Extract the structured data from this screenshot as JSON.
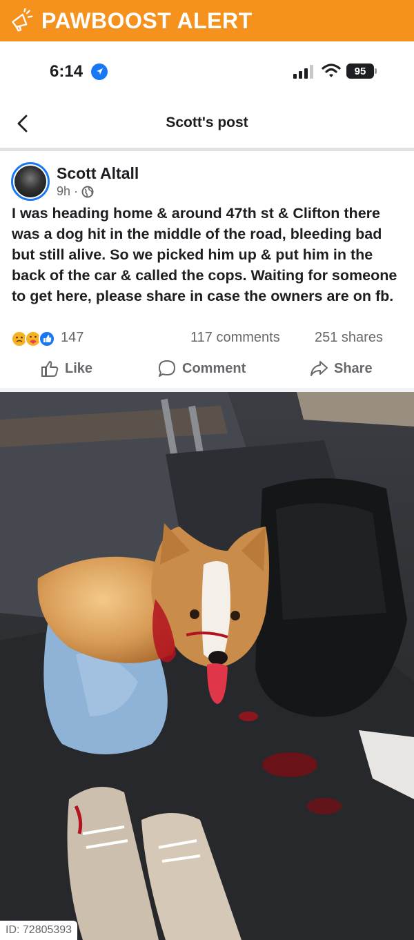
{
  "banner": {
    "title": "PAWBOOST ALERT",
    "color": "#f5921e",
    "icon": "megaphone-icon"
  },
  "status_bar": {
    "time": "6:14",
    "battery": "95"
  },
  "nav": {
    "title": "Scott's post"
  },
  "post": {
    "author": "Scott Altall",
    "time": "9h",
    "text": "I was heading home & around 47th st & Clifton there was a dog hit in the middle of the road, bleeding bad but still alive.  So we picked him up & put him in the back of the car & called the cops.  Waiting for someone to get here, please share in case the owners are on fb.",
    "reaction_count": "147",
    "comments": "117 comments",
    "shares": "251 shares"
  },
  "actions": {
    "like": "Like",
    "comment": "Comment",
    "share": "Share"
  },
  "photo": {
    "id_label": "ID: 72805393"
  }
}
